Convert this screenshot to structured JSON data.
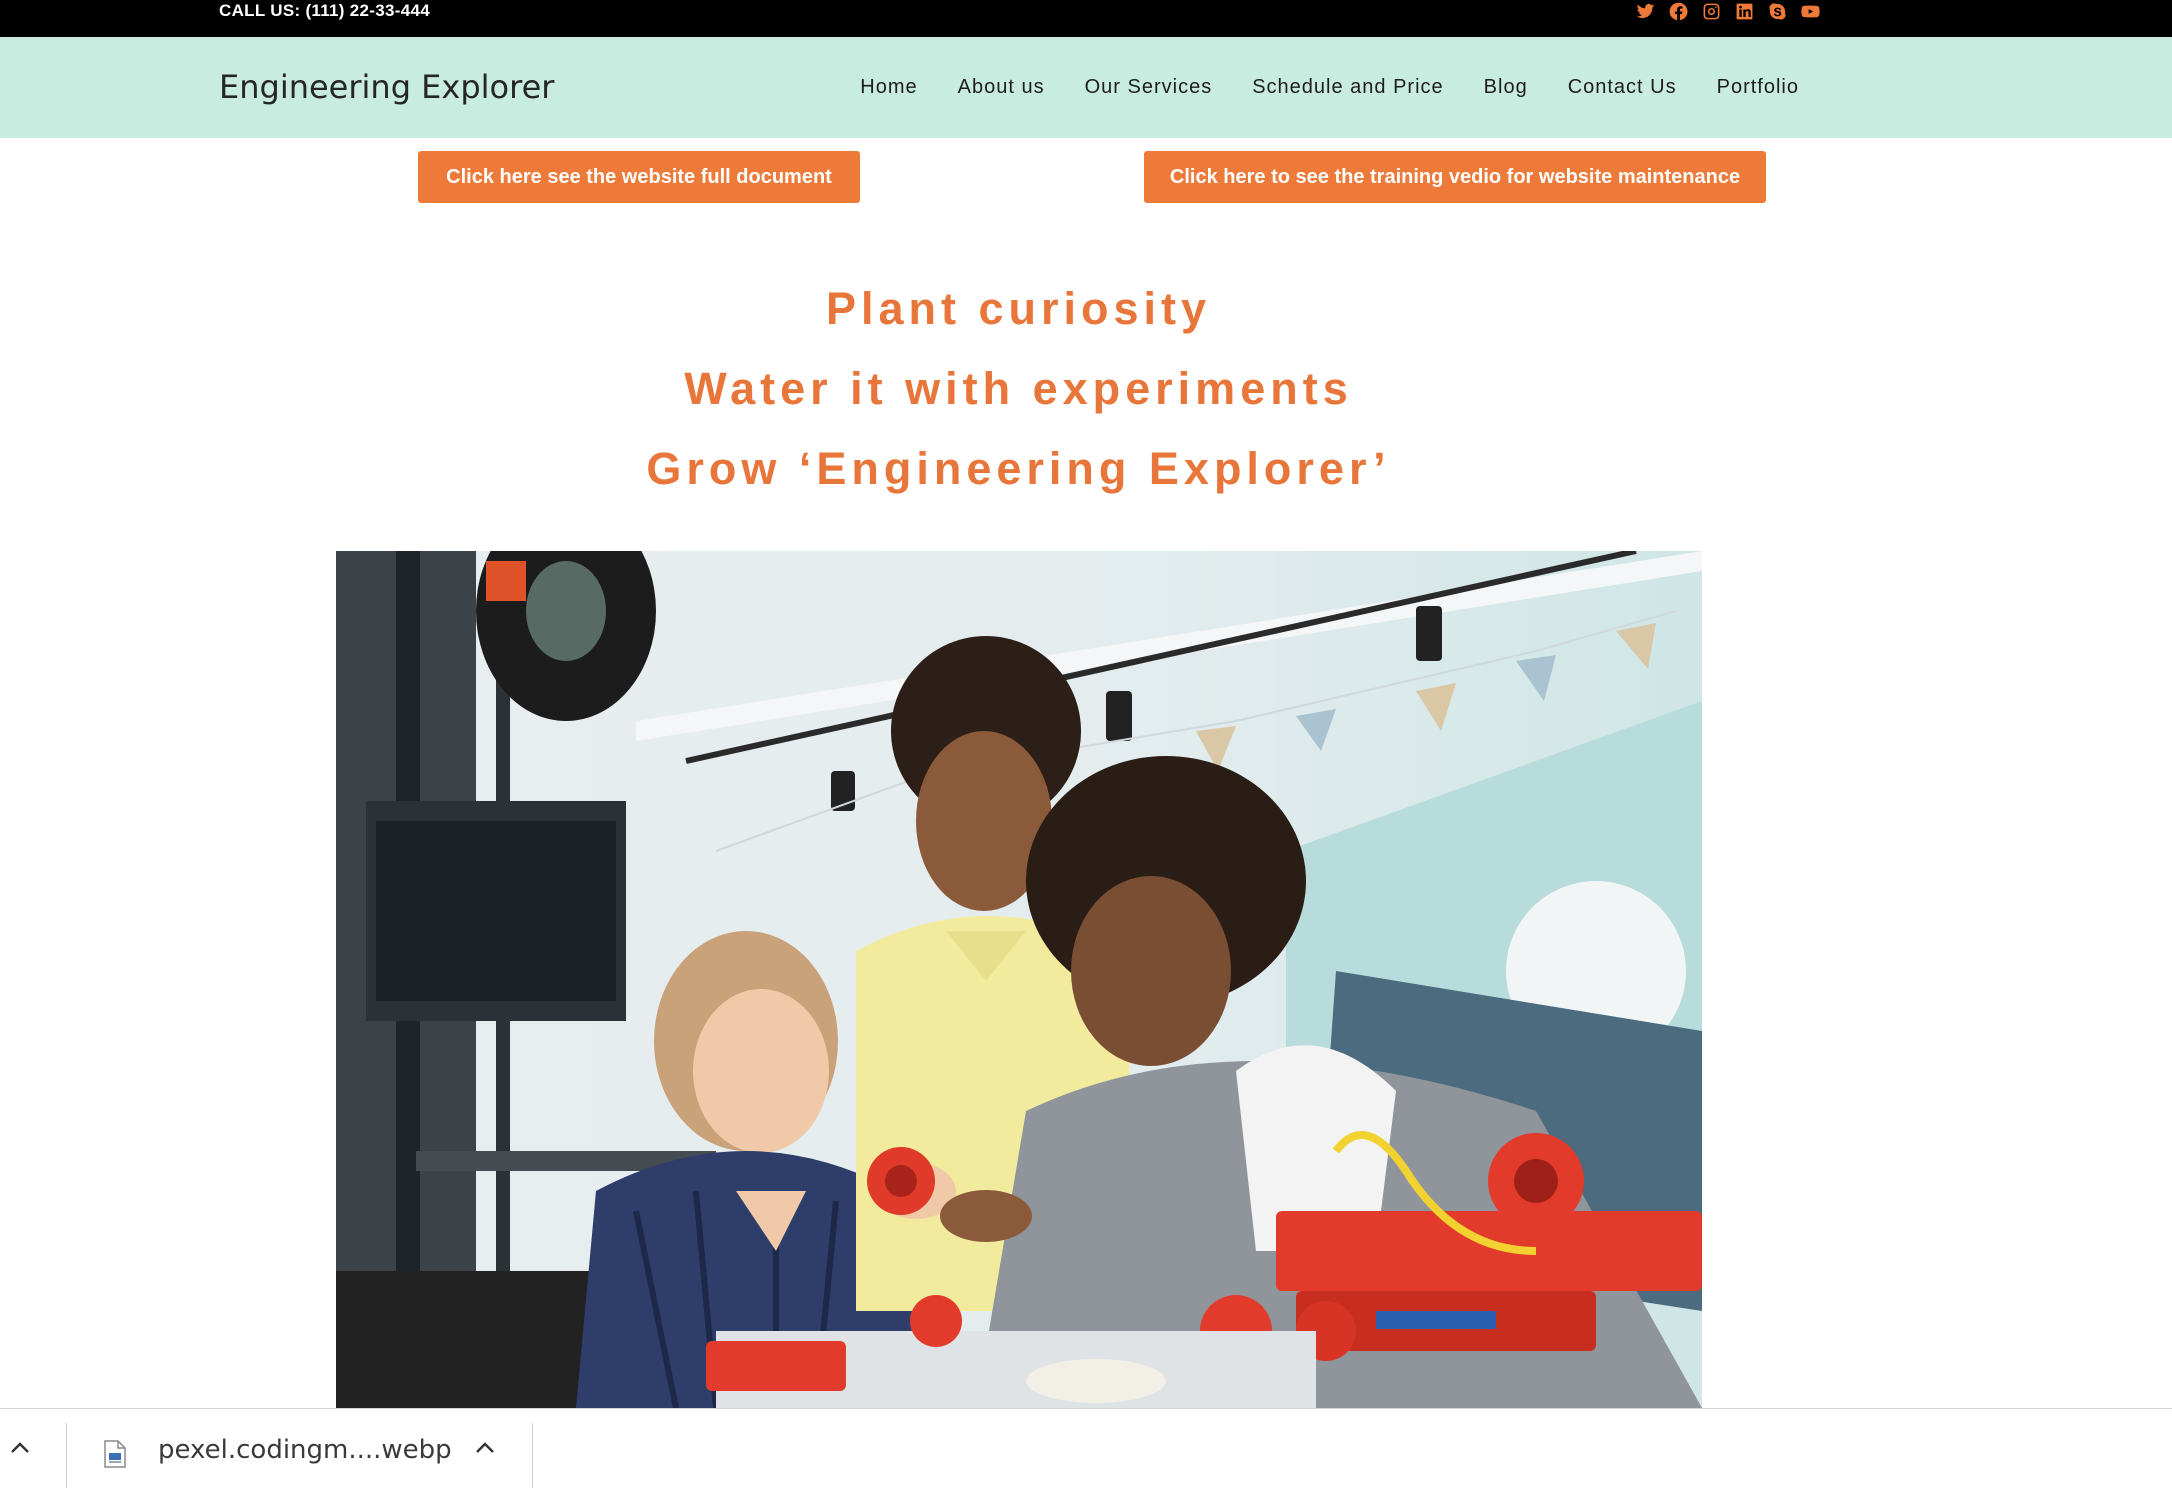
{
  "topbar": {
    "phone": "CALL US: (111) 22-33-444",
    "social_icons": [
      "twitter-icon",
      "facebook-icon",
      "instagram-icon",
      "linkedin-icon",
      "skype-icon",
      "youtube-icon"
    ],
    "icon_color": "#ee7a3a"
  },
  "header": {
    "brand": "Engineering Explorer",
    "nav": [
      "Home",
      "About us",
      "Our Services",
      "Schedule and Price",
      "Blog",
      "Contact Us",
      "Portfolio"
    ],
    "background": "#c9ece0"
  },
  "buttons": {
    "document": "Click here see the website full document",
    "video": "Click here to see the training vedio for website maintenance",
    "color": "#ee7a3a"
  },
  "tagline": {
    "line1": "Plant curiosity",
    "line2": "Water it with experiments",
    "line3": "Grow  ‘Engineering Explorer’",
    "color": "#e8763a"
  },
  "hero": {
    "subject": "three students building a robot with 3D printer in a classroom"
  },
  "download_shelf": {
    "file_name": "pexel.codingm....webp"
  }
}
